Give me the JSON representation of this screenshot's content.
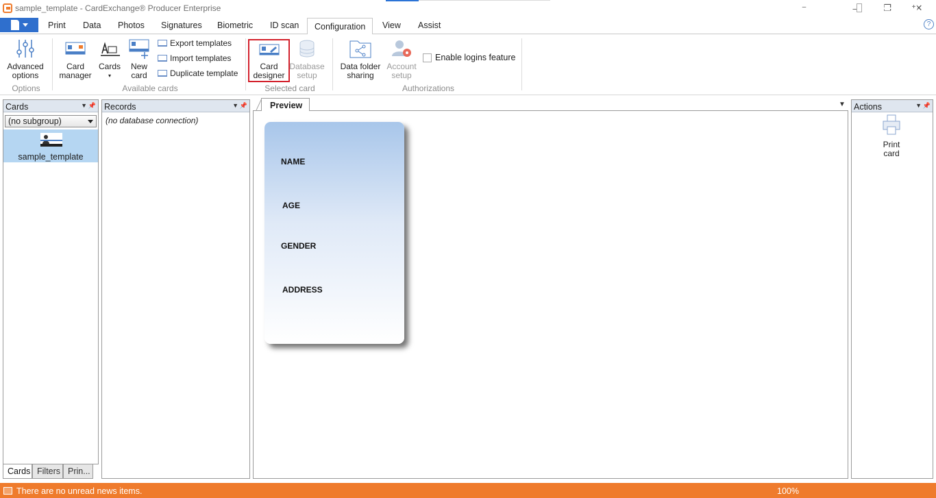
{
  "window": {
    "title": "sample_template - CardExchange® Producer Enterprise",
    "controls": {
      "minimize": "—",
      "restore": "❐",
      "close": "✕"
    }
  },
  "ribbon": {
    "tabs": [
      "Print",
      "Data",
      "Photos",
      "Signatures",
      "Biometric",
      "ID scan",
      "Configuration",
      "View",
      "Assist"
    ],
    "active_tab": "Configuration",
    "help": "?",
    "groups": {
      "options": {
        "label": "Options",
        "advanced_options": "Advanced options"
      },
      "available_cards": {
        "label": "Available cards",
        "card_manager": "Card manager",
        "cards": "Cards",
        "new_card": "New card",
        "export_templates": "Export templates",
        "import_templates": "Import templates",
        "duplicate_template": "Duplicate template"
      },
      "selected_card": {
        "label": "Selected card",
        "card_designer": "Card designer",
        "database_setup": "Database setup"
      },
      "authorizations": {
        "label": "Authorizations",
        "data_folder_sharing": "Data folder sharing",
        "account_setup": "Account setup",
        "enable_logins": "Enable logins feature"
      }
    }
  },
  "cards_panel": {
    "title": "Cards",
    "subgroup": "(no subgroup)",
    "items": [
      {
        "label": "sample_template"
      }
    ],
    "bottom_tabs": [
      "Cards",
      "Filters",
      "Prin..."
    ]
  },
  "records_panel": {
    "title": "Records",
    "message": "(no database connection)"
  },
  "preview": {
    "tab": "Preview",
    "card_fields": [
      "NAME",
      "AGE",
      "GENDER",
      "ADDRESS"
    ]
  },
  "actions_panel": {
    "title": "Actions",
    "print_card": "Print card"
  },
  "statusbar": {
    "news": "There are no unread news items.",
    "zoom": "100%",
    "zoom_level": 0.5
  },
  "colors": {
    "accent": "#2f6fcd",
    "status_bar": "#ef7b2c",
    "highlight": "#d3202b",
    "selection": "#b5d6f2"
  }
}
